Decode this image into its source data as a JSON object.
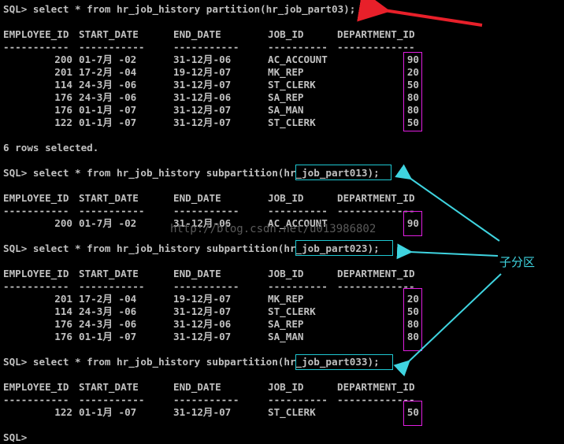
{
  "prompt": "SQL>",
  "q1": {
    "command": "select * from hr_job_history partition(hr_job_part03);",
    "headers": [
      "EMPLOYEE_ID",
      "START_DATE",
      "END_DATE",
      "JOB_ID",
      "DEPARTMENT_ID"
    ],
    "sep": [
      "-----------",
      "-----------",
      "-----------",
      "----------",
      "-------------"
    ],
    "rows": [
      [
        "200",
        "01-7月 -02",
        "31-12月-06",
        "AC_ACCOUNT",
        "90"
      ],
      [
        "201",
        "17-2月 -04",
        "19-12月-07",
        "MK_REP",
        "20"
      ],
      [
        "114",
        "24-3月 -06",
        "31-12月-07",
        "ST_CLERK",
        "50"
      ],
      [
        "176",
        "24-3月 -06",
        "31-12月-06",
        "SA_REP",
        "80"
      ],
      [
        "176",
        "01-1月 -07",
        "31-12月-07",
        "SA_MAN",
        "80"
      ],
      [
        "122",
        "01-1月 -07",
        "31-12月-07",
        "ST_CLERK",
        "50"
      ]
    ],
    "footer": "6 rows selected."
  },
  "q2": {
    "command": "select * from hr_job_history subpartition(hr_job_part013);",
    "rows": [
      [
        "200",
        "01-7月 -02",
        "31-12月-06",
        "AC_ACCOUNT",
        "90"
      ]
    ]
  },
  "q3": {
    "command": "select * from hr_job_history subpartition(hr_job_part023);",
    "rows": [
      [
        "201",
        "17-2月 -04",
        "19-12月-07",
        "MK_REP",
        "20"
      ],
      [
        "114",
        "24-3月 -06",
        "31-12月-07",
        "ST_CLERK",
        "50"
      ],
      [
        "176",
        "24-3月 -06",
        "31-12月-06",
        "SA_REP",
        "80"
      ],
      [
        "176",
        "01-1月 -07",
        "31-12月-07",
        "SA_MAN",
        "80"
      ]
    ]
  },
  "q4": {
    "command": "select * from hr_job_history subpartition(hr_job_part033);",
    "rows": [
      [
        "122",
        "01-1月 -07",
        "31-12月-07",
        "ST_CLERK",
        "50"
      ]
    ]
  },
  "watermark": "http://blog.csdn.net/u013986802",
  "annotation": "子分区",
  "colors": {
    "background": "#000000",
    "text": "#c0c0c0",
    "highlight_box": "#e01ee0",
    "subpartition_box": "#1ec8d2",
    "red_arrow": "#e8202a"
  }
}
